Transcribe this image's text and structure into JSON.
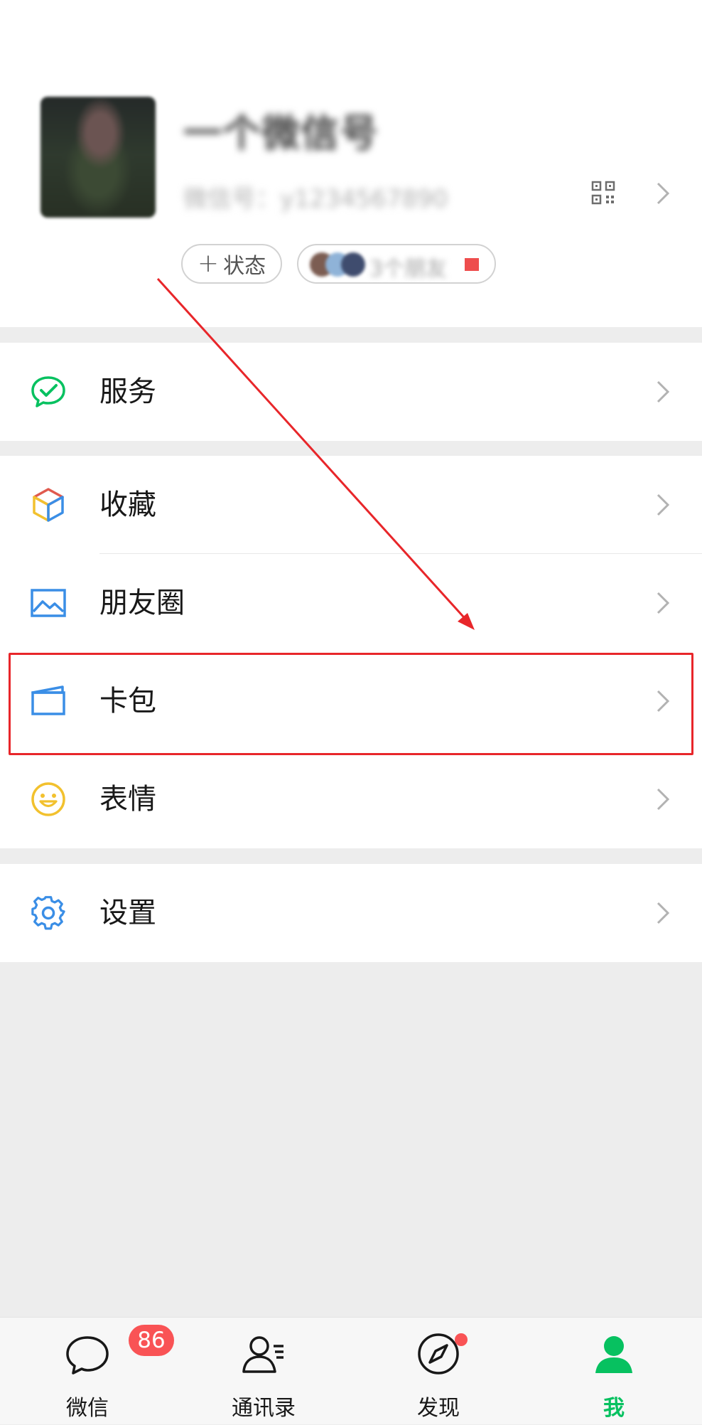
{
  "profile": {
    "nickname": "一个微信号",
    "wechat_id": "微信号：y1234567890",
    "status_label": "状态",
    "status_plus": "+",
    "friends_status_text": "3个朋友"
  },
  "menu": {
    "services": "服务",
    "favorites": "收藏",
    "moments": "朋友圈",
    "cards": "卡包",
    "stickers": "表情",
    "settings": "设置"
  },
  "tabbar": {
    "chats": "微信",
    "contacts": "通讯录",
    "discover": "发现",
    "me": "我",
    "chats_badge": "86"
  },
  "colors": {
    "accent_green": "#07c160",
    "badge_red": "#f95355",
    "annotation_red": "#e8262a"
  }
}
